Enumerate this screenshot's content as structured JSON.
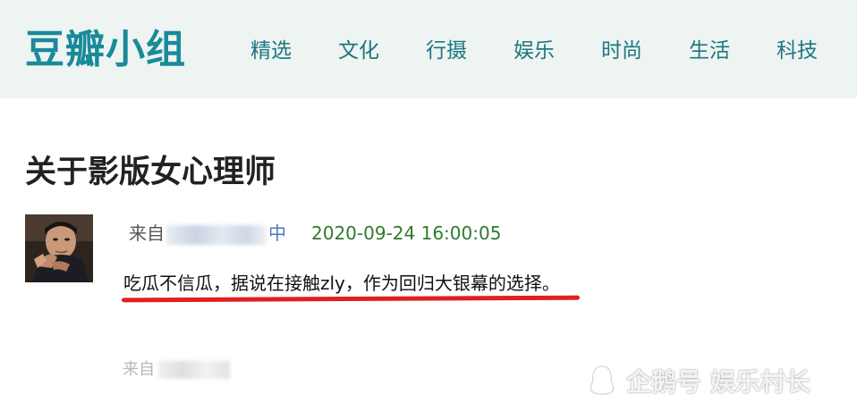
{
  "header": {
    "logo": "豆瓣小组",
    "nav": [
      "精选",
      "文化",
      "行摄",
      "娱乐",
      "时尚",
      "生活",
      "科技"
    ]
  },
  "post": {
    "title": "关于影版女心理师",
    "from_label": "来自",
    "group_suffix": "中",
    "timestamp": "2020-09-24 16:00:05",
    "comment": "吃瓜不信瓜，据说在接触zly，作为回归大银幕的选择。"
  },
  "next_item": {
    "from_label": "来自"
  },
  "watermark": {
    "text": "企鹅号 娱乐村长",
    "icon": "penguin-icon"
  },
  "colors": {
    "logo": "#1a8a9a",
    "nav": "#1d7680",
    "header_bg": "#eef4f2",
    "timestamp": "#2f7a2f",
    "underline": "#e0201c"
  }
}
